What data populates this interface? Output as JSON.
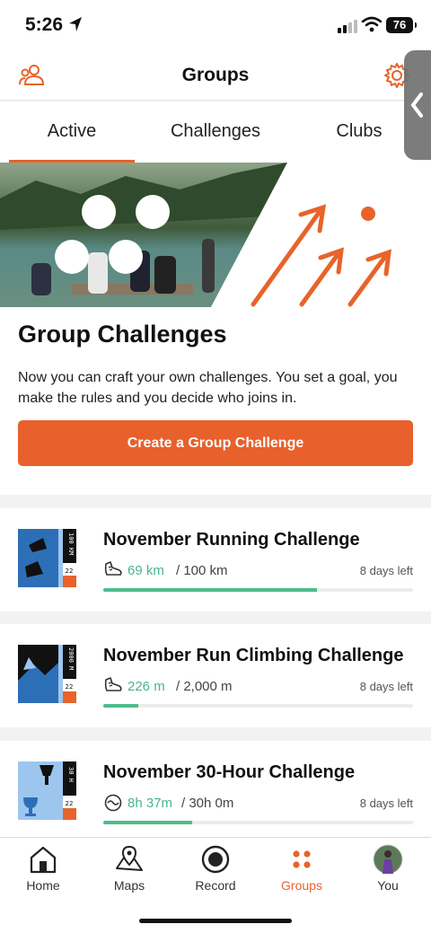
{
  "status": {
    "time": "5:26",
    "battery": "76"
  },
  "header": {
    "title": "Groups"
  },
  "tabs": [
    {
      "label": "Active"
    },
    {
      "label": "Challenges"
    },
    {
      "label": "Clubs"
    }
  ],
  "promo": {
    "title": "Group Challenges",
    "description": "Now you can craft your own challenges. You set a goal, you make the rules and you decide who joins in.",
    "button_label": "Create a Group Challenge"
  },
  "challenges": [
    {
      "title": "November Running Challenge",
      "progress": "69 km",
      "goal": "/ 100 km",
      "days_left": "8 days left",
      "fraction": 0.69,
      "badge_text": "100 KM",
      "badge_num": "22",
      "icon": "shoe-icon"
    },
    {
      "title": "November Run Climbing Challenge",
      "progress": "226 m",
      "goal": "/ 2,000 m",
      "days_left": "8 days left",
      "fraction": 0.113,
      "badge_text": "2000 M",
      "badge_num": "22",
      "icon": "shoe-icon"
    },
    {
      "title": "November 30-Hour Challenge",
      "progress": "8h 37m",
      "goal": "/ 30h 0m",
      "days_left": "8 days left",
      "fraction": 0.287,
      "badge_text": "30 H",
      "badge_num": "22",
      "icon": "stopwatch-icon"
    }
  ],
  "nav": [
    {
      "label": "Home",
      "icon": "home-icon"
    },
    {
      "label": "Maps",
      "icon": "map-icon"
    },
    {
      "label": "Record",
      "icon": "record-icon"
    },
    {
      "label": "Groups",
      "icon": "groups-icon",
      "active": true
    },
    {
      "label": "You",
      "icon": "avatar"
    }
  ],
  "colors": {
    "accent": "#e8632a",
    "progress": "#4cbc8b"
  }
}
